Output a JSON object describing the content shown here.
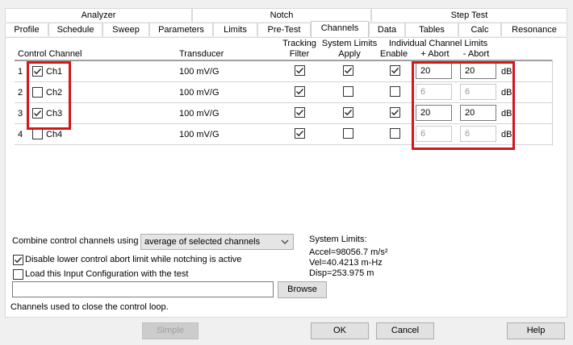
{
  "tab_groups": [
    "Analyzer",
    "Notch",
    "Step Test"
  ],
  "tabs": [
    "Profile",
    "Schedule",
    "Sweep",
    "Parameters",
    "Limits",
    "Pre-Test",
    "Channels",
    "Data",
    "Tables",
    "Calc",
    "Resonance"
  ],
  "selected_tab": "Channels",
  "headers": {
    "control_channel": "Control Channel",
    "transducer": "Transducer",
    "tracking": "Tracking",
    "filter": "Filter",
    "system_limits": "System Limits",
    "apply": "Apply",
    "individual_limits": "Individual Channel Limits",
    "enable": "Enable",
    "plus_abort": "+ Abort",
    "minus_abort": "- Abort"
  },
  "rows": [
    {
      "num": "1",
      "name": "Ch1",
      "control": true,
      "transducer": "100 mV/G",
      "tracking": true,
      "apply": true,
      "enable": true,
      "plus": "20",
      "minus": "20",
      "unit": "dB"
    },
    {
      "num": "2",
      "name": "Ch2",
      "control": false,
      "transducer": "100 mV/G",
      "tracking": true,
      "apply": false,
      "enable": false,
      "plus": "6",
      "minus": "6",
      "unit": "dB"
    },
    {
      "num": "3",
      "name": "Ch3",
      "control": true,
      "transducer": "100 mV/G",
      "tracking": true,
      "apply": true,
      "enable": true,
      "plus": "20",
      "minus": "20",
      "unit": "dB"
    },
    {
      "num": "4",
      "name": "Ch4",
      "control": false,
      "transducer": "100 mV/G",
      "tracking": true,
      "apply": false,
      "enable": false,
      "plus": "6",
      "minus": "6",
      "unit": "dB"
    }
  ],
  "combine": {
    "label": "Combine control channels using",
    "value": "average of selected channels"
  },
  "disable_lower": {
    "label": "Disable lower control abort limit while notching is active",
    "checked": true
  },
  "load_input": {
    "label": "Load this Input Configuration with the test",
    "checked": false
  },
  "path_value": "",
  "browse_label": "Browse",
  "system_limits": {
    "title": "System Limits:",
    "accel": "Accel=98056.7 m/s²",
    "vel": "Vel=40.4213 m-Hz",
    "disp": "Disp=253.975 m"
  },
  "status_text": "Channels used to close the control loop.",
  "buttons": {
    "simple": "Simple",
    "ok": "OK",
    "cancel": "Cancel",
    "help": "Help"
  }
}
